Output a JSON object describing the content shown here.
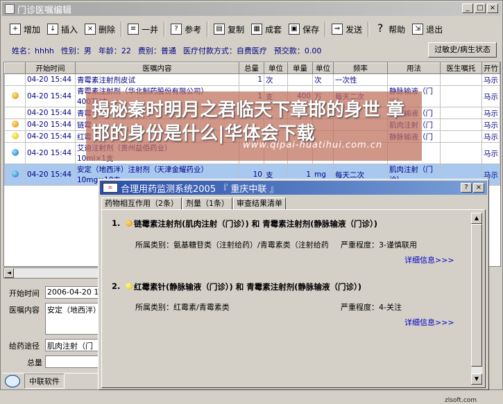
{
  "window": {
    "title": "门诊医嘱编辑",
    "controls": [
      "_",
      "□",
      "×"
    ]
  },
  "toolbar": {
    "add": "增加",
    "insert": "插入",
    "delete": "删除",
    "group": "一并",
    "reference": "参考",
    "copy": "复制",
    "package": "成套",
    "save": "保存",
    "send": "发送",
    "help": "帮助",
    "exit": "退出"
  },
  "patient": {
    "name": "姓名：hhhh",
    "gender": "性别：男",
    "age": "年龄：22",
    "fee_type": "费别：普通",
    "pay_method": "医疗付款方式：自费医疗",
    "deposit": "预交款：0.00",
    "allergy_button": "过敏史/病生状态"
  },
  "grid": {
    "headers": [
      "开始时间",
      "医嘱内容",
      "总量",
      "单位",
      "单量",
      "单位",
      "频率",
      "用法",
      "医生嘱托",
      "开竹"
    ],
    "rows": [
      {
        "dot": "",
        "time": "04-20 15:44",
        "content": "青霉素注射剂皮试",
        "content2": "",
        "total": "1",
        "unit": "次",
        "dose": "",
        "dose_unit": "次",
        "freq": "一次性",
        "usage": "",
        "usage2": "",
        "note": "",
        "doctor": "马示"
      },
      {
        "dot": "orange",
        "time": "04-20 15:44",
        "content": "青霉素注射剂（华北制药股份有限公司）",
        "content2": "400万/支",
        "total": "1",
        "unit": "支",
        "dose": "400",
        "dose_unit": "万",
        "freq": "每天二次",
        "usage": "静脉输液（门",
        "usage2": "诊）",
        "note": "",
        "doctor": "马示"
      },
      {
        "dot": "",
        "time": "04-20 15:44",
        "content": "青霉",
        "content2": "",
        "total": "",
        "unit": "",
        "dose": "",
        "dose_unit": "",
        "freq": "",
        "usage": "静脉输液（门",
        "usage2": "",
        "note": "",
        "doctor": "马示"
      },
      {
        "dot": "orange",
        "time": "04-20 15:44",
        "content": "链霉",
        "content2": "",
        "total": "",
        "unit": "",
        "dose": "",
        "dose_unit": "",
        "freq": "",
        "usage": "肌肉注射（门",
        "usage2": "",
        "note": "",
        "doctor": "马示"
      },
      {
        "dot": "yellow",
        "time": "04-20 15:44",
        "content": "红霉",
        "content2": "",
        "total": "",
        "unit": "",
        "dose": "",
        "dose_unit": "",
        "freq": "",
        "usage": "静脉输液（门",
        "usage2": "",
        "note": "",
        "doctor": "马示"
      },
      {
        "dot": "blue",
        "time": "04-20 15:44",
        "content": "艾迪注射剂（贵州益佰药业）",
        "content2": "10ml×1支",
        "total": "",
        "unit": "",
        "dose": "",
        "dose_unit": "",
        "freq": "",
        "usage": "",
        "usage2": "",
        "note": "",
        "doctor": "马示"
      },
      {
        "dot": "blue",
        "time": "04-20 15:44",
        "content": "安定（地西泮）注射剂（天津金耀药业）",
        "content2": "10mg×10支",
        "total": "10",
        "unit": "支",
        "dose": "1",
        "dose_unit": "mg",
        "freq": "每天二次",
        "usage": "肌肉注射（门",
        "usage2": "诊）",
        "note": "",
        "doctor": "马示"
      }
    ]
  },
  "detail": {
    "start_label": "开始时间",
    "start_value": "2006-04-20 1",
    "content_label": "医嘱内容",
    "content_value": "安定（地西泮）",
    "route_label": "给药途径",
    "route_value": "肌肉注射（门",
    "total_label": "总量",
    "total_value": ""
  },
  "status": {
    "company": "中联软件"
  },
  "overlay": {
    "headline": "揭秘秦时明月之君临天下章邯的身世 章邯的身份是什么|华体会下载",
    "url": "www.qipai-huatihui.com.cn"
  },
  "dialog": {
    "title": "合理用药监测系统2005 『 重庆中联 』",
    "tabs": [
      "药物相互作用（2条）",
      "剂量（1条）",
      "审查结果清单"
    ],
    "items": [
      {
        "index": "1.",
        "dot": "orange",
        "text": "链霉素注射剂(肌肉注射（门诊）) 和 青霉素注射剂(静脉输液（门诊）)",
        "category": "所属类别：氨基糖苷类（注射给药）/青霉素类（注射给药",
        "severity": "严重程度：3-谨慎联用",
        "link": "详细信息>>>"
      },
      {
        "index": "2.",
        "dot": "yellow",
        "text": "红霉素针(静脉输液（门诊）) 和 青霉素注射剂(静脉输液（门诊）)",
        "category": "所属类别：红霉素/青霉素类",
        "severity": "严重程度：4-关注",
        "link": "详细信息>>>"
      }
    ],
    "watermark": "zlsoft.com"
  }
}
